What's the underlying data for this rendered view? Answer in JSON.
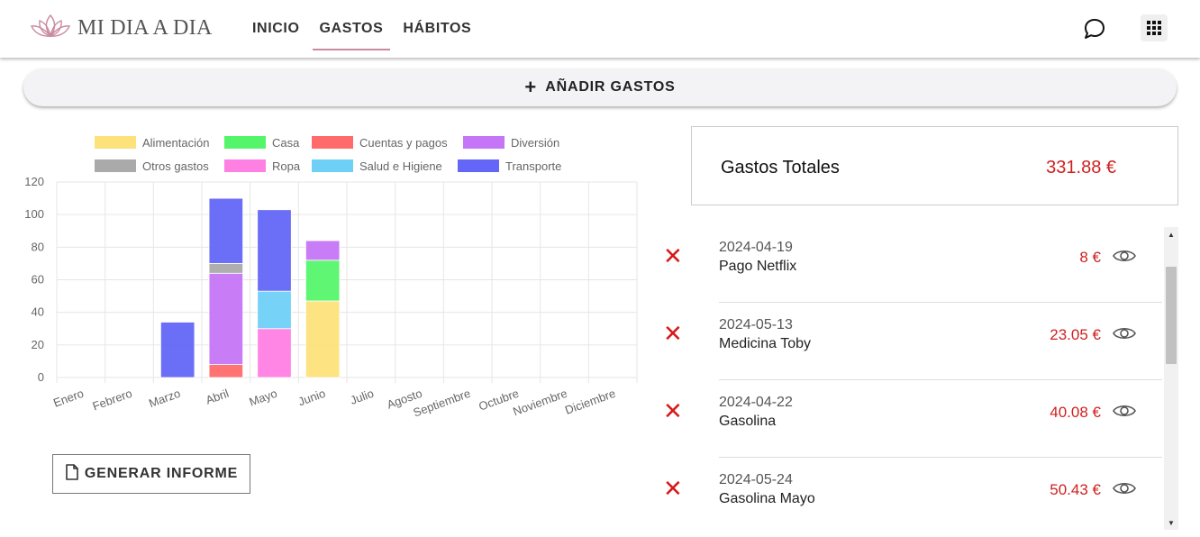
{
  "app": {
    "title": "MI DIA A DIA"
  },
  "nav": {
    "items": [
      {
        "label": "INICIO",
        "active": false
      },
      {
        "label": "GASTOS",
        "active": true
      },
      {
        "label": "HÁBITOS",
        "active": false
      }
    ]
  },
  "icons": {
    "logo": "lotus-icon",
    "chat": "chat-bubble-icon",
    "apps": "apps-grid-icon",
    "add": "plus-icon",
    "report": "document-icon",
    "delete": "close-icon",
    "view": "eye-icon"
  },
  "actions": {
    "add_label": "AÑADIR GASTOS",
    "report_label": "GENERAR INFORME"
  },
  "totals": {
    "label": "Gastos Totales",
    "value": "331.88 €"
  },
  "expenses": [
    {
      "date": "2024-04-19",
      "name": "Pago Netflix",
      "amount": "8 €"
    },
    {
      "date": "2024-05-13",
      "name": "Medicina Toby",
      "amount": "23.05 €"
    },
    {
      "date": "2024-04-22",
      "name": "Gasolina",
      "amount": "40.08 €"
    },
    {
      "date": "2024-05-24",
      "name": "Gasolina Mayo",
      "amount": "50.43 €"
    }
  ],
  "colors": {
    "accent": "#c98aa0",
    "amount": "#d02020",
    "delete": "#d81818"
  },
  "chart_data": {
    "type": "bar",
    "stacked": true,
    "categories": [
      "Enero",
      "Febrero",
      "Marzo",
      "Abril",
      "Mayo",
      "Junio",
      "Julio",
      "Agosto",
      "Septiembre",
      "Octubre",
      "Noviembre",
      "Diciembre"
    ],
    "series": [
      {
        "name": "Alimentación",
        "color": "#fde17a",
        "values": [
          0,
          0,
          0,
          0,
          0,
          47,
          0,
          0,
          0,
          0,
          0,
          0
        ]
      },
      {
        "name": "Casa",
        "color": "#55f56b",
        "values": [
          0,
          0,
          0,
          0,
          0,
          25,
          0,
          0,
          0,
          0,
          0,
          0
        ]
      },
      {
        "name": "Cuentas y pagos",
        "color": "#ff6b6b",
        "values": [
          0,
          0,
          0,
          8,
          0,
          0,
          0,
          0,
          0,
          0,
          0,
          0
        ]
      },
      {
        "name": "Diversión",
        "color": "#c576f6",
        "values": [
          0,
          0,
          0,
          56,
          0,
          12,
          0,
          0,
          0,
          0,
          0,
          0
        ]
      },
      {
        "name": "Otros gastos",
        "color": "#aaaaaa",
        "values": [
          0,
          0,
          0,
          6,
          0,
          0,
          0,
          0,
          0,
          0,
          0,
          0
        ]
      },
      {
        "name": "Ropa",
        "color": "#ff80e3",
        "values": [
          0,
          0,
          0,
          0,
          30,
          0,
          0,
          0,
          0,
          0,
          0,
          0
        ]
      },
      {
        "name": "Salud e Higiene",
        "color": "#6fd0f7",
        "values": [
          0,
          0,
          0,
          0,
          23,
          0,
          0,
          0,
          0,
          0,
          0,
          0
        ]
      },
      {
        "name": "Transporte",
        "color": "#6366f7",
        "values": [
          0,
          0,
          34,
          40,
          50,
          0,
          0,
          0,
          0,
          0,
          0,
          0
        ]
      }
    ],
    "ylim": [
      0,
      120
    ],
    "yticks": [
      0,
      20,
      40,
      60,
      80,
      100,
      120
    ],
    "grid": true,
    "legend": "top"
  }
}
